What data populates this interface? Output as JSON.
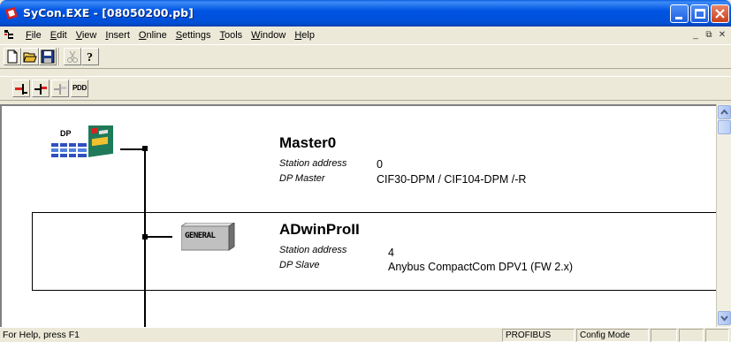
{
  "window": {
    "title": "SyCon.EXE - [08050200.pb]"
  },
  "menu": {
    "items": [
      {
        "label": "File",
        "underline": "F",
        "rest": "ile"
      },
      {
        "label": "Edit",
        "underline": "E",
        "rest": "dit"
      },
      {
        "label": "View",
        "underline": "V",
        "rest": "iew"
      },
      {
        "label": "Insert",
        "underline": "I",
        "rest": "nsert"
      },
      {
        "label": "Online",
        "underline": "O",
        "rest": "nline"
      },
      {
        "label": "Settings",
        "underline": "S",
        "rest": "ettings"
      },
      {
        "label": "Tools",
        "underline": "T",
        "rest": "ools"
      },
      {
        "label": "Window",
        "underline": "W",
        "rest": "indow"
      },
      {
        "label": "Help",
        "underline": "H",
        "rest": "elp"
      }
    ]
  },
  "toolbar2": {
    "pdd_label": "PDD"
  },
  "master": {
    "icon_label": "DP",
    "name": "Master0",
    "station_address_label": "Station address",
    "station_address": "0",
    "type_label": "DP Master",
    "type_value": "CIF30-DPM / CIF104-DPM /-R"
  },
  "slave": {
    "icon_label": "GENERAL",
    "name": "ADwinProII",
    "station_address_label": "Station address",
    "station_address": "4",
    "type_label": "DP Slave",
    "type_value": "Anybus CompactCom DPV1 (FW 2.x)"
  },
  "statusbar": {
    "help_text": "For Help, press F1",
    "bus": "PROFIBUS",
    "mode": "Config Mode"
  },
  "colors": {
    "titlebar": "#0054e3",
    "chrome": "#ece9d8",
    "workspace": "#ffffff"
  }
}
